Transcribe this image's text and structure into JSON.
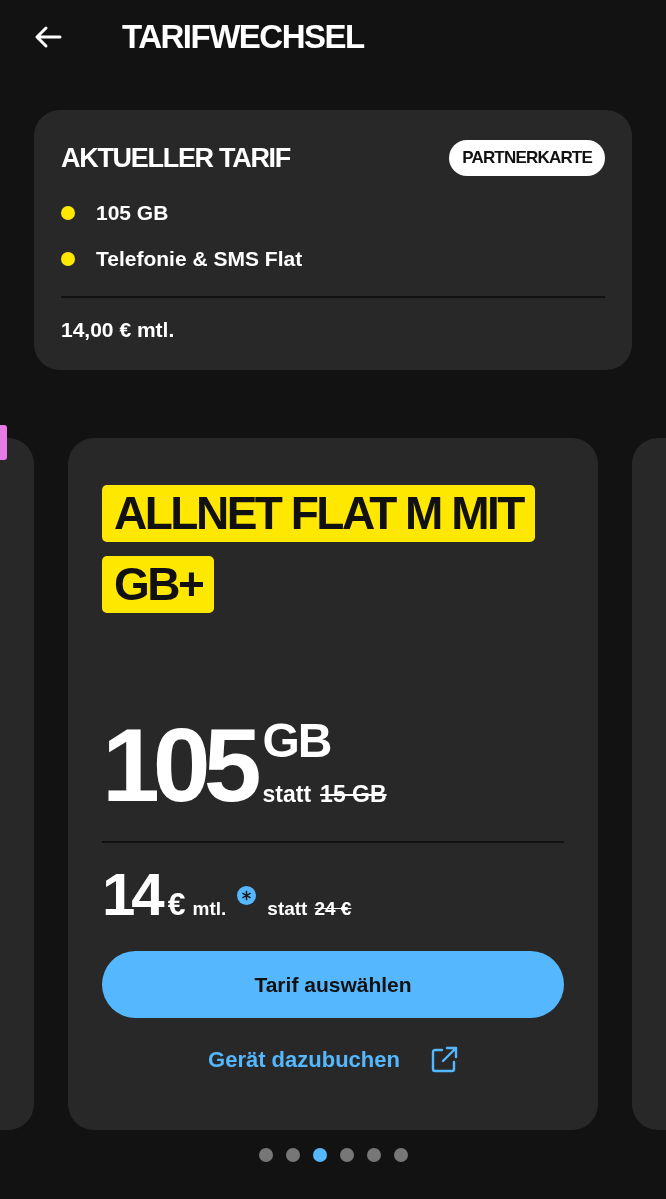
{
  "header": {
    "title": "TARIFWECHSEL"
  },
  "current_tariff": {
    "title": "AKTUELLER TARIF",
    "badge": "PARTNERKARTE",
    "features": [
      "105 GB",
      "Telefonie & SMS Flat"
    ],
    "price": "14,00 € mtl."
  },
  "offer": {
    "name_lines": [
      "ALLNET FLAT M MIT",
      "GB+"
    ],
    "data_amount": "105",
    "data_unit": "GB",
    "data_statt": "statt",
    "data_old": "15 GB",
    "price": "14",
    "currency": "€",
    "period": "mtl.",
    "price_statt": "statt",
    "price_old": "24 €",
    "select_button": "Tarif auswählen",
    "device_link": "Gerät dazubuchen"
  },
  "pagination": [
    {
      "selected": false
    },
    {
      "selected": false
    },
    {
      "selected": true
    },
    {
      "selected": false
    },
    {
      "selected": false
    },
    {
      "selected": false
    }
  ]
}
